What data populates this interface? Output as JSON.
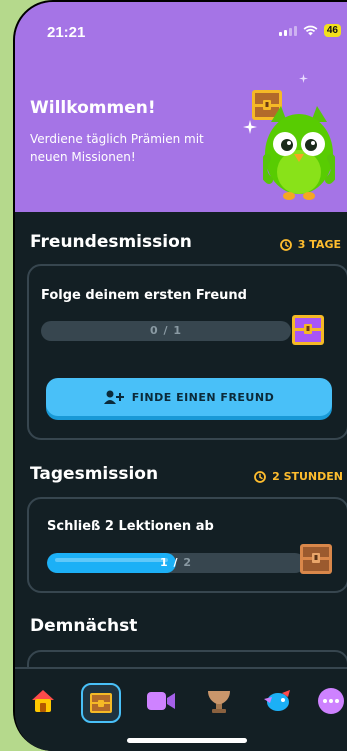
{
  "status_bar": {
    "time": "21:21",
    "battery": "46"
  },
  "hero": {
    "title": "Willkommen!",
    "subtitle": "Verdiene täglich Prämien mit neuen Missionen!"
  },
  "friend_mission": {
    "title": "Freundesmission",
    "timer": "3 TAGE",
    "quest": "Folge deinem ersten Freund",
    "progress_current": "0",
    "progress_sep": " / ",
    "progress_total": "1",
    "progress_fraction": 0,
    "button_label": "FINDE EINEN FREUND"
  },
  "daily_mission": {
    "title": "Tagesmission",
    "timer": "2 STUNDEN",
    "quest": "Schließ 2 Lektionen ab",
    "progress_current": "1",
    "progress_sep": " / ",
    "progress_total": "2",
    "progress_fraction": 0.5
  },
  "upcoming": {
    "title": "Demnächst"
  },
  "nav": [
    {
      "name": "home-icon"
    },
    {
      "name": "quests-chest-icon",
      "active": true
    },
    {
      "name": "video-call-icon"
    },
    {
      "name": "leagues-icon"
    },
    {
      "name": "bird-icon"
    },
    {
      "name": "more-icon"
    }
  ],
  "colors": {
    "hero_bg": "#a574e6",
    "accent_blue": "#49c0f8",
    "timer_gold": "#ffbd2e",
    "track": "#37464f",
    "background": "#131f24"
  }
}
